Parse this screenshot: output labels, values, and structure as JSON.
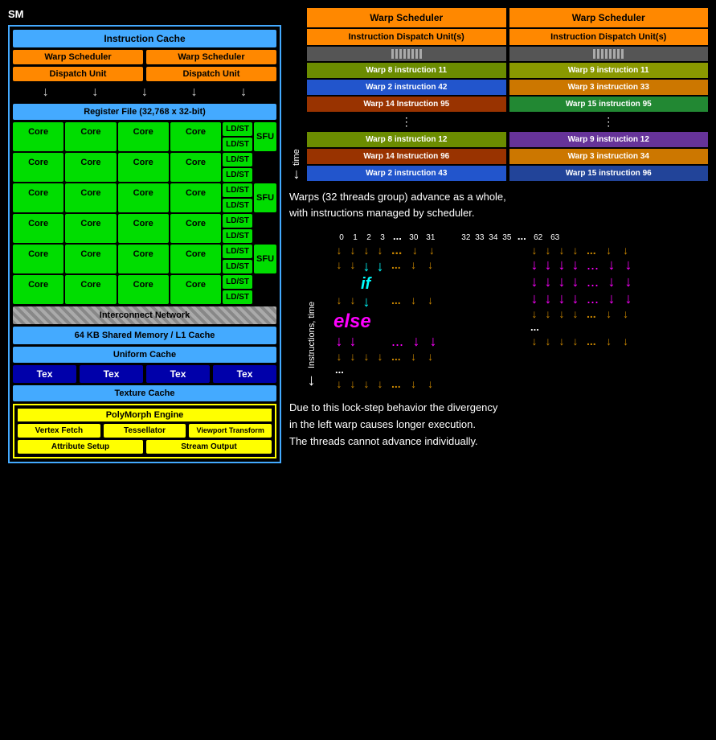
{
  "sm": {
    "label": "SM",
    "instruction_cache": "Instruction Cache",
    "warp_scheduler_1": "Warp Scheduler",
    "warp_scheduler_2": "Warp Scheduler",
    "dispatch_unit_1": "Dispatch Unit",
    "dispatch_unit_2": "Dispatch Unit",
    "register_file": "Register File (32,768 x 32-bit)",
    "core_label": "Core",
    "ldst_label": "LD/ST",
    "sfu_label": "SFU",
    "interconnect": "Interconnect Network",
    "shared_mem": "64 KB Shared Memory / L1 Cache",
    "uniform_cache": "Uniform Cache",
    "tex_label": "Tex",
    "texture_cache": "Texture Cache",
    "polymorph_engine": "PolyMorph Engine",
    "vertex_fetch": "Vertex Fetch",
    "tessellator": "Tessellator",
    "viewport_transform": "Viewport Transform",
    "attribute_setup": "Attribute Setup",
    "stream_output": "Stream Output"
  },
  "warp_diagram": {
    "col1": {
      "warp_scheduler": "Warp Scheduler",
      "idu": "Instruction Dispatch Unit(s)",
      "instructions": [
        {
          "label": "Warp 8 instruction 11",
          "color": "#6b8c00"
        },
        {
          "label": "Warp 2 instruction 42",
          "color": "#2255cc"
        },
        {
          "label": "Warp 14 Instruction 95",
          "color": "#993300"
        },
        {
          "label": "⋮",
          "color": "transparent"
        },
        {
          "label": "Warp 8 instruction 12",
          "color": "#6b8c00"
        },
        {
          "label": "Warp 14 Instruction 96",
          "color": "#993300"
        },
        {
          "label": "Warp 2 instruction 43",
          "color": "#2255cc"
        }
      ]
    },
    "col2": {
      "warp_scheduler": "Warp Scheduler",
      "idu": "Instruction Dispatch Unit(s)",
      "instructions": [
        {
          "label": "Warp 9 instruction 11",
          "color": "#8a9900"
        },
        {
          "label": "Warp 3 instruction 33",
          "color": "#cc7700"
        },
        {
          "label": "Warp 15 instruction 95",
          "color": "#228833"
        },
        {
          "label": "⋮",
          "color": "transparent"
        },
        {
          "label": "Warp 9 instruction 12",
          "color": "#663399"
        },
        {
          "label": "Warp 3 instruction 34",
          "color": "#cc7700"
        },
        {
          "label": "Warp 15 instruction 96",
          "color": "#224499"
        }
      ]
    }
  },
  "description1": "Warps (32 threads group) advance as a whole,",
  "description2": "with instructions managed by scheduler.",
  "thread_nums": {
    "group1": [
      "0",
      "1",
      "2",
      "3"
    ],
    "dots1": "...",
    "group2": [
      "30",
      "31"
    ],
    "gap": "",
    "group3": [
      "32",
      "33",
      "34",
      "35"
    ],
    "dots2": "...",
    "group4": [
      "62",
      "63"
    ]
  },
  "if_label": "if",
  "else_label": "else",
  "y_axis_label": "Instructions, time",
  "description3": "Due to this lock-step behavior the divergency",
  "description4": "in the left warp causes longer execution.",
  "description5": "The threads cannot advance individually."
}
